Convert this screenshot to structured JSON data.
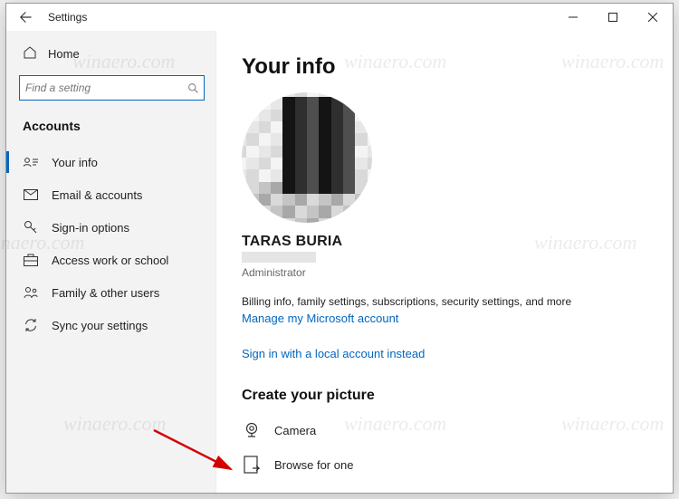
{
  "titlebar": {
    "title": "Settings"
  },
  "sidebar": {
    "home": "Home",
    "search_placeholder": "Find a setting",
    "section": "Accounts",
    "items": [
      {
        "label": "Your info"
      },
      {
        "label": "Email & accounts"
      },
      {
        "label": "Sign-in options"
      },
      {
        "label": "Access work or school"
      },
      {
        "label": "Family & other users"
      },
      {
        "label": "Sync your settings"
      }
    ]
  },
  "main": {
    "title": "Your info",
    "user_name": "TARAS BURIA",
    "user_role": "Administrator",
    "billing_text": "Billing info, family settings, subscriptions, security settings, and more",
    "manage_link": "Manage my Microsoft account",
    "local_link": "Sign in with a local account instead",
    "picture_heading": "Create your picture",
    "camera_label": "Camera",
    "browse_label": "Browse for one"
  },
  "watermark": "winaero.com"
}
